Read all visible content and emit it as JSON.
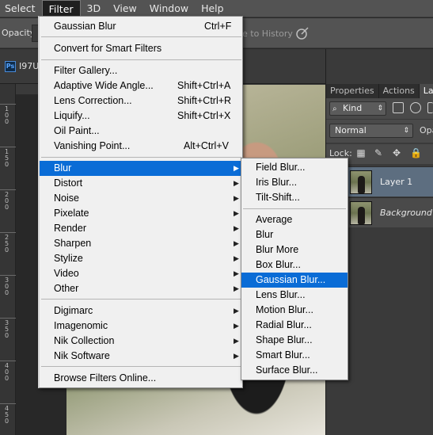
{
  "menubar": {
    "items": [
      "Select",
      "Filter",
      "3D",
      "View",
      "Window",
      "Help"
    ]
  },
  "options": {
    "opacity_label": "Opacity:",
    "history_text": "e to History",
    "airbrush_icon": "airbrush-icon"
  },
  "document": {
    "app_badge": "Ps",
    "tab_title": "I97U"
  },
  "ruler": {
    "labels": [
      "1",
      "0",
      "0",
      "1",
      "5",
      "0",
      "2",
      "0",
      "0",
      "2",
      "5",
      "0",
      "3",
      "0",
      "0",
      "3",
      "5",
      "0",
      "4",
      "0",
      "0",
      "4",
      "5",
      "0"
    ]
  },
  "panel": {
    "tabs": [
      "Properties",
      "Actions",
      "Lay"
    ],
    "kind_label": "Kind",
    "blend_mode": "Normal",
    "opacity_short": "Opa",
    "lock_label": "Lock:",
    "layers": [
      {
        "name": "Layer 1",
        "selected": true
      },
      {
        "name": "Background",
        "selected": false
      }
    ]
  },
  "filter_menu": {
    "last_filter": {
      "label": "Gaussian Blur",
      "shortcut": "Ctrl+F"
    },
    "smart": "Convert for Smart Filters",
    "group1": [
      {
        "label": "Filter Gallery...",
        "shortcut": ""
      },
      {
        "label": "Adaptive Wide Angle...",
        "shortcut": "Shift+Ctrl+A"
      },
      {
        "label": "Lens Correction...",
        "shortcut": "Shift+Ctrl+R"
      },
      {
        "label": "Liquify...",
        "shortcut": "Shift+Ctrl+X"
      },
      {
        "label": "Oil Paint...",
        "shortcut": ""
      },
      {
        "label": "Vanishing Point...",
        "shortcut": "Alt+Ctrl+V"
      }
    ],
    "group2": [
      "Blur",
      "Distort",
      "Noise",
      "Pixelate",
      "Render",
      "Sharpen",
      "Stylize",
      "Video",
      "Other"
    ],
    "group3": [
      "Digimarc",
      "Imagenomic",
      "Nik Collection",
      "Nik Software"
    ],
    "browse": "Browse Filters Online...",
    "highlighted": "Blur",
    "submenu_arrow": "▶"
  },
  "blur_menu": {
    "group1": [
      "Field Blur...",
      "Iris Blur...",
      "Tilt-Shift..."
    ],
    "group2": [
      "Average",
      "Blur",
      "Blur More",
      "Box Blur...",
      "Gaussian Blur...",
      "Lens Blur...",
      "Motion Blur...",
      "Radial Blur...",
      "Shape Blur...",
      "Smart Blur...",
      "Surface Blur..."
    ],
    "highlighted": "Gaussian Blur..."
  },
  "colors": {
    "highlight": "#0a6cd6",
    "menu_bg": "#f0f0f0",
    "chrome": "#535353"
  }
}
